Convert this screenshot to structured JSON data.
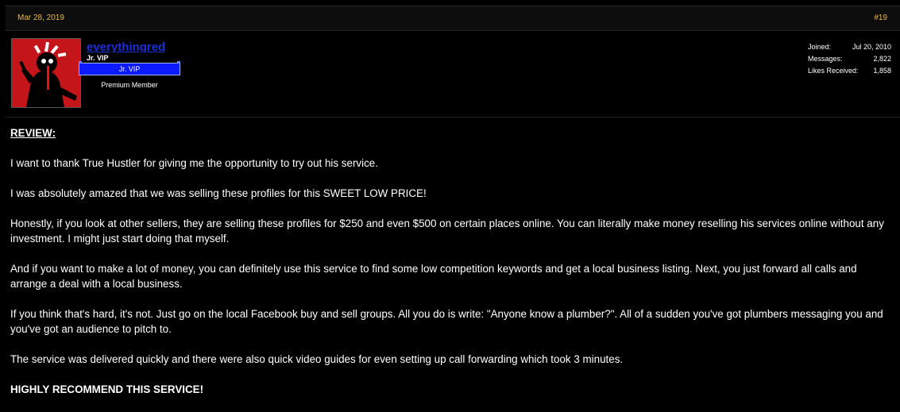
{
  "post": {
    "date": "Mar 28, 2019",
    "number": "#19"
  },
  "user": {
    "name": "everythingred",
    "title": "Jr. VIP",
    "rank_banner": "Jr. VIP",
    "member_type": "Premium Member",
    "stats": [
      {
        "label": "Joined:",
        "value": "Jul 20, 2010"
      },
      {
        "label": "Messages:",
        "value": "2,822"
      },
      {
        "label": "Likes Received:",
        "value": "1,858"
      }
    ]
  },
  "body": {
    "heading": "REVIEW:",
    "paragraphs": [
      "I want to thank True Hustler for giving me the opportunity to try out his service.",
      "I was absolutely amazed that we was selling these profiles for this SWEET LOW PRICE!",
      "Honestly, if you look at other sellers, they are selling these profiles for $250 and even $500 on certain places online. You can literally make money reselling his services online without any investment. I might just start doing that myself.",
      "And if you want to make a lot of money, you can definitely use this service to find some low competition keywords and get a local business listing. Next, you just forward all calls and arrange a deal with a local business.",
      "If you think that's hard, it's not. Just go on the local Facebook buy and sell groups. All you do is write: \"Anyone know a plumber?\". All of a sudden you've got plumbers messaging you and you've got an audience to pitch to.",
      "The service was delivered quickly and there were also quick video guides for even setting up call forwarding which took 3 minutes."
    ],
    "closing": "HIGHLY RECOMMEND THIS SERVICE!"
  },
  "colors": {
    "accent_date": "#e8b94a",
    "username": "#1a2fd6",
    "rank_banner": "#0b1aff",
    "avatar_bg": "#c4151b"
  }
}
